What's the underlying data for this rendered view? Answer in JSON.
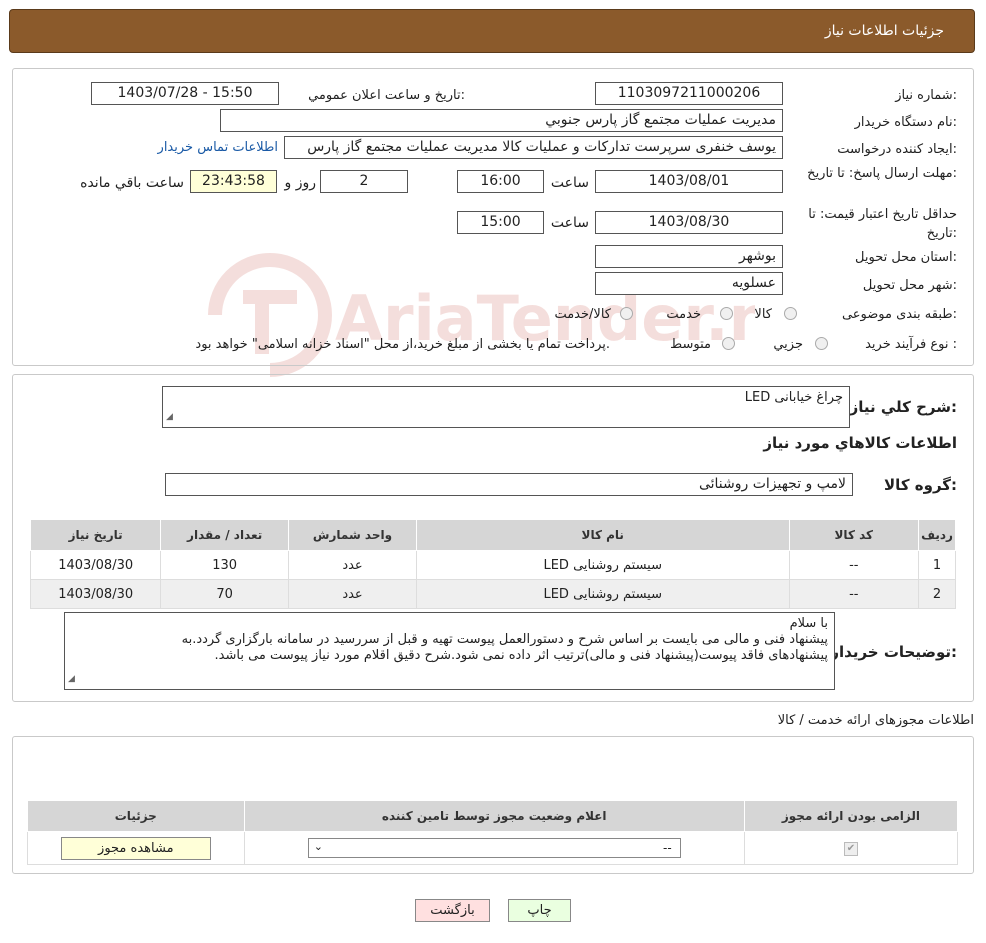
{
  "window": {
    "title": "جزئیات اطلاعات نیاز"
  },
  "watermark": {
    "text": "AriaTender.neT"
  },
  "form": {
    "need_number_label": "شماره نیاز:",
    "need_number": "1103097211000206",
    "announce_label": "تاريخ و ساعت اعلان عمومي:",
    "announce_value": "1403/07/28 - 15:50",
    "buyer_org_label": "نام دستگاه خريدار:",
    "buyer_org": "مديريت عمليات مجتمع گاز پارس جنوبي",
    "requester_label": "ايجاد کننده درخواست:",
    "requester": "یوسف خنفری سرپرست تدارکات و عملیات کالا مدیریت عملیات مجتمع گاز پارس",
    "buyer_contact_link": "اطلاعات تماس خريدار",
    "reply_deadline_label": "مهلت ارسال پاسخ: تا تاريخ:",
    "reply_date": "1403/08/01",
    "time_label": "ساعت",
    "reply_time": "16:00",
    "days_value": "2",
    "days_label": "روز و",
    "remaining_time": "23:43:58",
    "remaining_label": "ساعت باقي مانده",
    "price_validity_label": "حداقل تاريخ اعتبار قيمت: تا تاريخ:",
    "price_date": "1403/08/30",
    "time_label2": "ساعت",
    "price_time": "15:00",
    "province_label": "استان محل تحويل:",
    "province": "بوشهر",
    "city_label": "شهر محل تحويل:",
    "city": "عسلويه",
    "category_label": "طبقه بندی موضوعی:",
    "category_options": [
      "کالا",
      "خدمت",
      "کالا/خدمت"
    ],
    "process_label": "نوع فرآيند خريد :",
    "process_options": [
      "جزيي",
      "متوسط"
    ],
    "process_note": "پرداخت تمام يا بخشی از مبلغ خريد،از محل \"اسناد خزانه اسلامی\" خواهد بود."
  },
  "description": {
    "label": "شرح کلي نياز:",
    "value": "چراغ خیابانی LED",
    "items_header": "اطلاعات کالاهاي مورد نياز",
    "group_label": "گروه کالا:",
    "group_value": "لامپ و تجهيزات روشنائی"
  },
  "items_table": {
    "headers": [
      "رديف",
      "کد کالا",
      "نام کالا",
      "واحد شمارش",
      "تعداد / مقدار",
      "تاريخ نياز"
    ],
    "rows": [
      [
        "1",
        "--",
        "سیستم روشنایی LED",
        "عدد",
        "130",
        "1403/08/30"
      ],
      [
        "2",
        "--",
        "سیستم روشنایی LED",
        "عدد",
        "70",
        "1403/08/30"
      ]
    ]
  },
  "buyer_notes": {
    "label": "توضيحات خريدار:",
    "lines": [
      "با سلام",
      "پیشنهاد فنی و مالی می بایست بر اساس شرح و دستورالعمل پیوست تهیه و قبل از سررسید در سامانه بارگزاری گردد.به",
      "پیشنهادهای فاقد پیوست(پیشنهاد فنی و مالی)ترتیب اثر داده نمی شود.شرح دقیق اقلام مورد نیاز پیوست می باشد."
    ]
  },
  "permits": {
    "title": "اطلاعات مجوزهای ارائه خدمت / کالا",
    "headers": [
      "الزامی بودن ارائه مجوز",
      "اعلام وضعيت مجوز توسط تامين کننده",
      "جزئيات"
    ],
    "select_value": "--",
    "view_button": "مشاهده مجوز"
  },
  "buttons": {
    "print": "چاپ",
    "back": "بازگشت"
  },
  "colors": {
    "title_bar": "#8b5a2b",
    "print_btn": "#eaffe0",
    "back_btn": "#ffe0e0",
    "highlight": "#ffffd8"
  }
}
